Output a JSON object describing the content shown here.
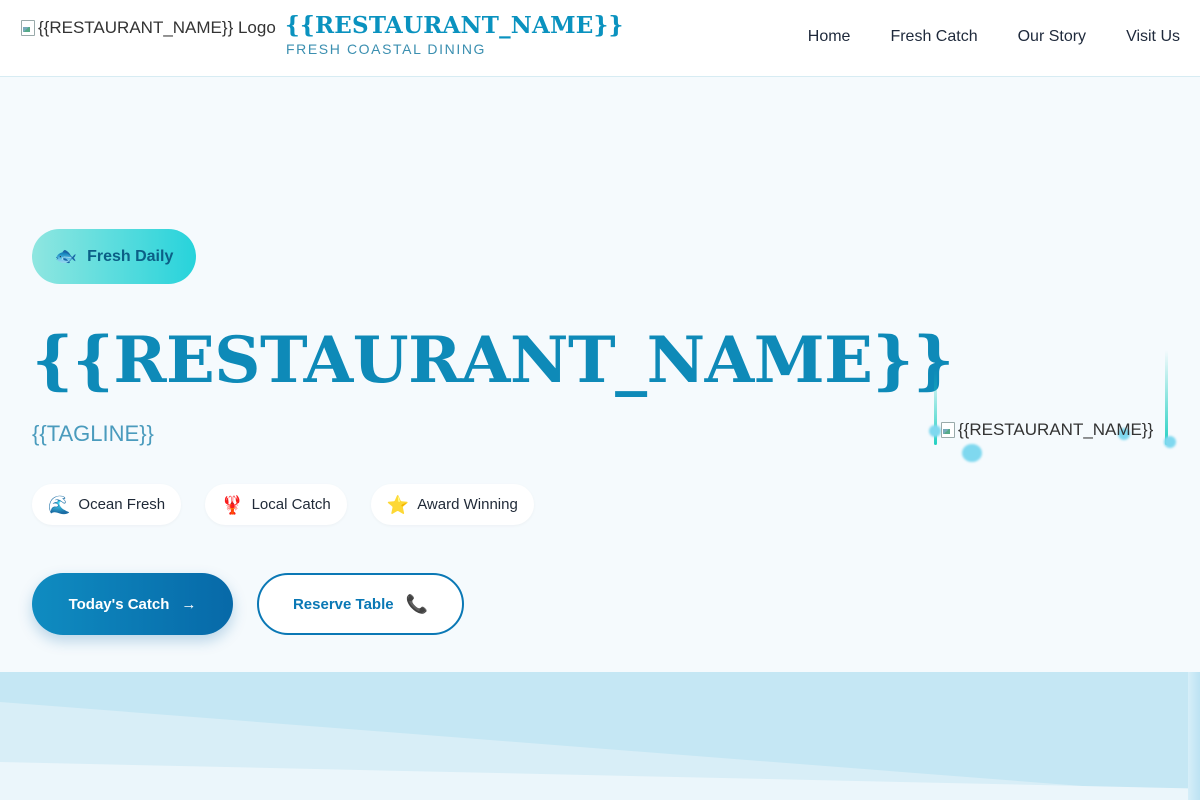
{
  "header": {
    "logo_alt": "{{RESTAURANT_NAME}} Logo",
    "brand_name": "{{RESTAURANT_NAME}}",
    "brand_sub": "FRESH COASTAL DINING",
    "nav": [
      "Home",
      "Fresh Catch",
      "Our Story",
      "Visit Us"
    ]
  },
  "hero": {
    "badge": {
      "icon": "fish-icon",
      "glyph": "🐟",
      "label": "Fresh Daily"
    },
    "title": "{{RESTAURANT_NAME}}",
    "tagline": "{{TAGLINE}}",
    "features": [
      {
        "icon": "wave-icon",
        "glyph": "🌊",
        "label": "Ocean Fresh"
      },
      {
        "icon": "lobster-icon",
        "glyph": "🦞",
        "label": "Local Catch"
      },
      {
        "icon": "star-icon",
        "glyph": "⭐",
        "label": "Award Winning"
      }
    ],
    "primary_button": {
      "label": "Today's Catch",
      "icon": "arrow-right-icon",
      "glyph": "→"
    },
    "secondary_button": {
      "label": "Reserve Table",
      "icon": "phone-icon",
      "glyph": "📞"
    },
    "image_alt": "{{RESTAURANT_NAME}}"
  },
  "colors": {
    "brand": "#0a92bf",
    "accent_teal": "#27d3db",
    "primary_button": "#0769a8",
    "background": "#f5fafd"
  }
}
